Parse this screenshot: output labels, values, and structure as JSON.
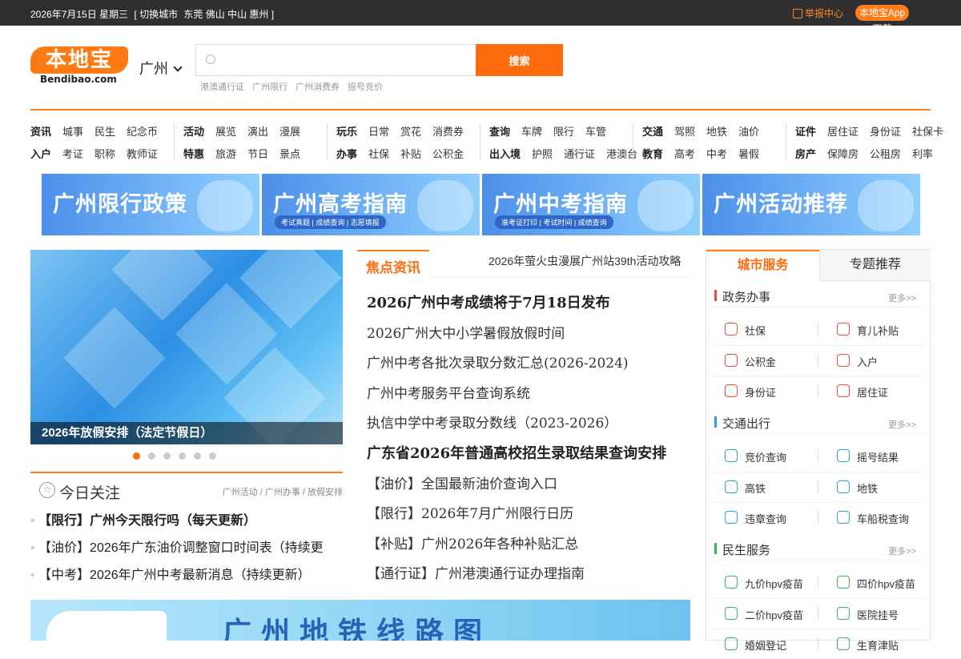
{
  "topbar": {
    "date": "2026年7月15日 星期三",
    "switch_label": "[ 切换城市",
    "cities": "东莞 佛山 中山 惠州 ]",
    "report": "举报中心",
    "app": "本地宝App下载"
  },
  "logo": {
    "cn": "本地宝",
    "en": "Bendibao.com"
  },
  "city": "广州",
  "search": {
    "placeholder": "",
    "button": "搜索",
    "hot": [
      "港澳通行证",
      "广州限行",
      "广州消费券",
      "摇号竞价"
    ]
  },
  "nav": [
    {
      "rows": [
        [
          "资讯",
          "城事",
          "民生",
          "纪念币"
        ],
        [
          "入户",
          "考证",
          "职称",
          "教师证"
        ]
      ]
    },
    {
      "rows": [
        [
          "活动",
          "展览",
          "演出",
          "漫展"
        ],
        [
          "特惠",
          "旅游",
          "节日",
          "景点"
        ]
      ]
    },
    {
      "rows": [
        [
          "玩乐",
          "日常",
          "赏花",
          "消费券"
        ],
        [
          "办事",
          "社保",
          "补贴",
          "公积金"
        ]
      ]
    },
    {
      "rows": [
        [
          "查询",
          "车牌",
          "限行",
          "车管"
        ],
        [
          "出入境",
          "护照",
          "通行证",
          "港澳台"
        ]
      ]
    },
    {
      "rows": [
        [
          "交通",
          "驾照",
          "地铁",
          "油价"
        ],
        [
          "教育",
          "高考",
          "中考",
          "暑假"
        ]
      ]
    },
    {
      "rows": [
        [
          "证件",
          "居住证",
          "身份证",
          "社保卡"
        ],
        [
          "房产",
          "保障房",
          "公租房",
          "利率"
        ]
      ]
    }
  ],
  "banners": [
    {
      "title": "广州限行政策",
      "sub": ""
    },
    {
      "title": "广州高考指南",
      "sub": "考试真题 | 成绩查询 | 志愿填报"
    },
    {
      "title": "广州中考指南",
      "sub": "准考证打印 | 考试时间 | 成绩查询"
    },
    {
      "title": "广州活动推荐",
      "sub": ""
    }
  ],
  "hero": {
    "caption": "2026年放假安排（法定节假日）",
    "dots": 6,
    "active": 0
  },
  "today": {
    "title": "今日关注",
    "crumb": "广州活动 / 广州办事 / 放假安排",
    "items": [
      {
        "text": "【限行】广州今天限行吗（每天更新）",
        "bold": true
      },
      {
        "text": "【油价】2026年广东油价调整窗口时间表（持续更",
        "bold": false
      },
      {
        "text": "【中考】2026年广州中考最新消息（持续更新）",
        "bold": false
      }
    ]
  },
  "focus": {
    "tab": "焦点资讯",
    "ticker": "2026年萤火虫漫展广州站39th活动攻略",
    "items": [
      {
        "text": "2026广州中考成绩将于7月18日发布",
        "hl": true
      },
      {
        "text": "2026广州大中小学暑假放假时间",
        "hl": false
      },
      {
        "text": "广州中考各批次录取分数汇总(2026-2024)",
        "hl": false
      },
      {
        "text": "广州中考服务平台查询系统",
        "hl": false
      },
      {
        "text": "执信中学中考录取分数线（2023-2026）",
        "hl": false
      },
      {
        "text": "广东省2026年普通高校招生录取结果查询安排",
        "hl": true
      },
      {
        "text": "【油价】全国最新油价查询入口",
        "hl": false
      },
      {
        "text": "【限行】2026年7月广州限行日历",
        "hl": false
      },
      {
        "text": "【补贴】广州2026年各种补贴汇总",
        "hl": false
      },
      {
        "text": "【通行证】广州港澳通行证办理指南",
        "hl": false
      }
    ]
  },
  "metro": {
    "title": "广州地铁线路图"
  },
  "side": {
    "tab_active": "城市服务",
    "tab_other": "专题推荐",
    "more": "更多>>",
    "sections": [
      {
        "name": "政务办事",
        "color": "#e94b3c",
        "items": [
          {
            "label": "社保",
            "icon": "shield-icon",
            "color": "#e94b3c"
          },
          {
            "label": "育儿补贴",
            "icon": "coin-icon",
            "color": "#e94b3c"
          },
          {
            "label": "公积金",
            "icon": "house-icon",
            "color": "#e94b3c"
          },
          {
            "label": "入户",
            "icon": "doc-icon",
            "color": "#e94b3c"
          },
          {
            "label": "身份证",
            "icon": "id-card-icon",
            "color": "#e94b3c"
          },
          {
            "label": "居住证",
            "icon": "card-icon",
            "color": "#e94b3c"
          }
        ]
      },
      {
        "name": "交通出行",
        "color": "#2ca0d8",
        "items": [
          {
            "label": "竞价查询",
            "icon": "gauge-icon",
            "color": "#2ca0d8"
          },
          {
            "label": "摇号结果",
            "icon": "ticket-icon",
            "color": "#2ca0d8"
          },
          {
            "label": "高铁",
            "icon": "train-icon",
            "color": "#2ca0d8"
          },
          {
            "label": "地铁",
            "icon": "metro-icon",
            "color": "#2ca0d8"
          },
          {
            "label": "违章查询",
            "icon": "car-icon",
            "color": "#2ca0d8"
          },
          {
            "label": "车船税查询",
            "icon": "tax-icon",
            "color": "#2ca0d8"
          }
        ]
      },
      {
        "name": "民生服务",
        "color": "#3cb35a",
        "items": [
          {
            "label": "九价hpv疫苗",
            "icon": "medkit-icon",
            "color": "#3cb35a"
          },
          {
            "label": "四价hpv疫苗",
            "icon": "clock-icon",
            "color": "#3cb35a"
          },
          {
            "label": "二价hpv疫苗",
            "icon": "star-icon",
            "color": "#3cb35a"
          },
          {
            "label": "医院挂号",
            "icon": "star-icon",
            "color": "#3cb35a"
          },
          {
            "label": "婚姻登记",
            "icon": "star-icon",
            "color": "#3cb35a"
          },
          {
            "label": "生育津贴",
            "icon": "star-icon",
            "color": "#3cb35a"
          }
        ]
      }
    ]
  }
}
